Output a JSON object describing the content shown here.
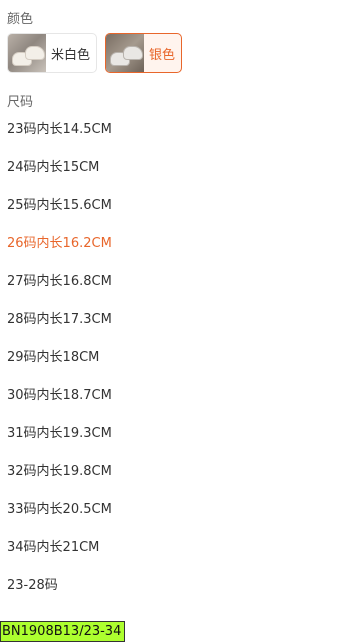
{
  "color_section": {
    "label": "颜色",
    "options": [
      {
        "label": "米白色",
        "selected": false,
        "thumb": "shoe-photo-icon"
      },
      {
        "label": "银色",
        "selected": true,
        "thumb": "shoe-photo-icon"
      }
    ]
  },
  "size_section": {
    "label": "尺码",
    "options": [
      {
        "label": "23码内长14.5CM",
        "selected": false
      },
      {
        "label": "24码内长15CM",
        "selected": false
      },
      {
        "label": "25码内长15.6CM",
        "selected": false
      },
      {
        "label": "26码内长16.2CM",
        "selected": true
      },
      {
        "label": "27码内长16.8CM",
        "selected": false
      },
      {
        "label": "28码内长17.3CM",
        "selected": false
      },
      {
        "label": "29码内长18CM",
        "selected": false
      },
      {
        "label": "30码内长18.7CM",
        "selected": false
      },
      {
        "label": "31码内长19.3CM",
        "selected": false
      },
      {
        "label": "32码内长19.8CM",
        "selected": false
      },
      {
        "label": "33码内长20.5CM",
        "selected": false
      },
      {
        "label": "34码内长21CM",
        "selected": false
      },
      {
        "label": "23-28码",
        "selected": false
      }
    ]
  },
  "sku_tag": "BN1908B13/23-34",
  "colors": {
    "accent": "#e8662b",
    "text": "#333333",
    "muted": "#666666",
    "sku_background": "#adff2f"
  }
}
